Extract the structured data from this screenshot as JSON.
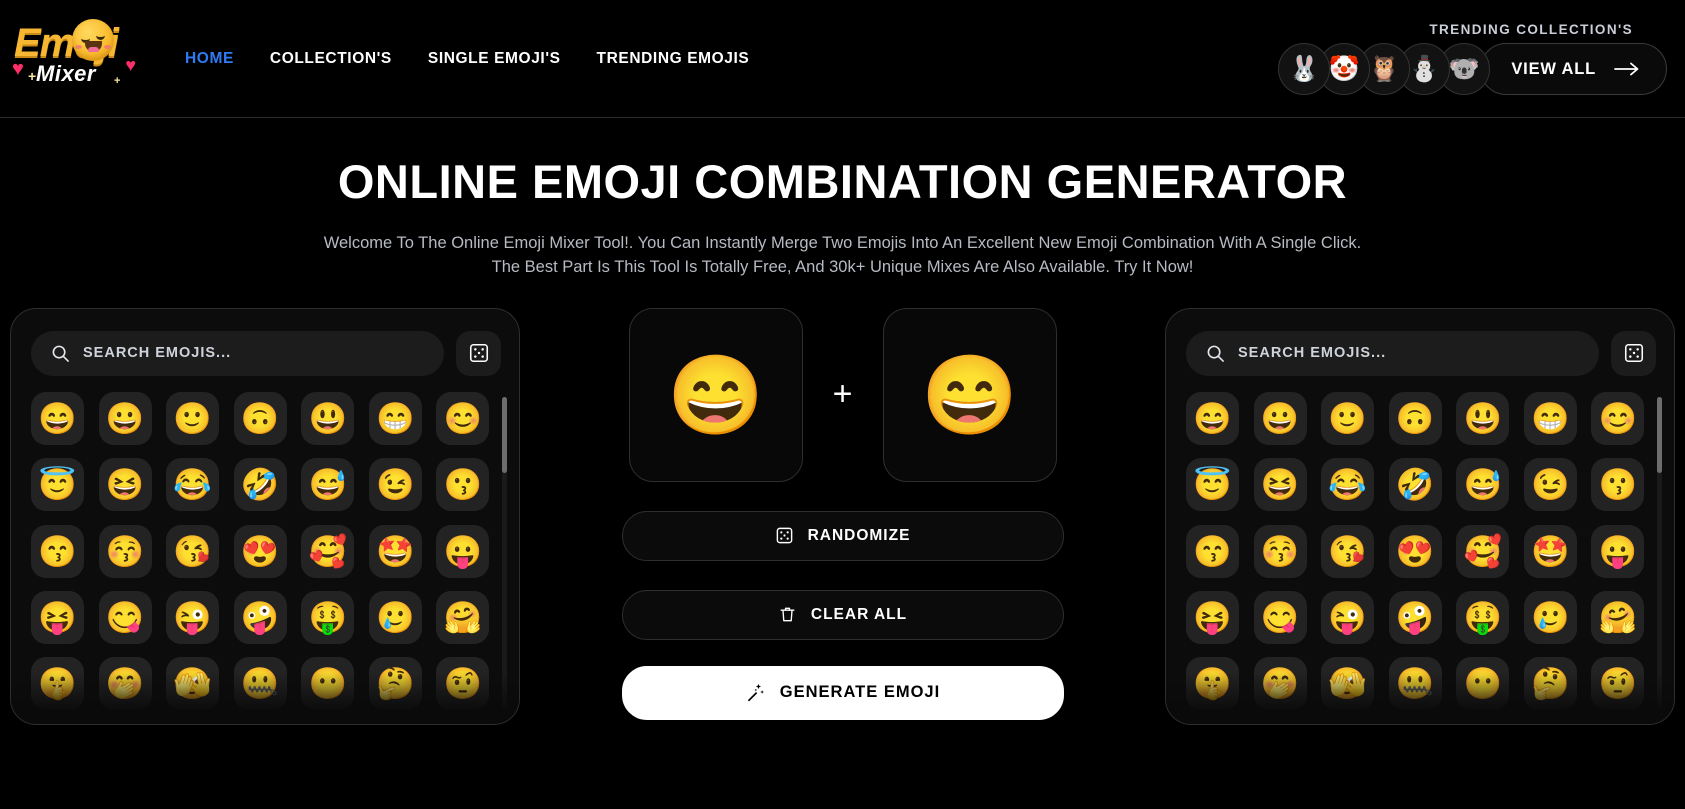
{
  "brand": {
    "logo_word": "Emoji",
    "logo_sub": "Mixer",
    "logo_plus_left": "+",
    "logo_plus_right": "+",
    "heart": "♥"
  },
  "nav": {
    "items": [
      {
        "label": "HOME",
        "active": true
      },
      {
        "label": "COLLECTION'S",
        "active": false
      },
      {
        "label": "SINGLE EMOJI'S",
        "active": false
      },
      {
        "label": "TRENDING EMOJIS",
        "active": false
      }
    ]
  },
  "header": {
    "trending_label": "TRENDING COLLECTION'S",
    "view_all_label": "VIEW ALL",
    "arrow_icon": "→",
    "avatars": [
      {
        "name": "rabbit-sunglasses-emoji",
        "glyph": "🐰"
      },
      {
        "name": "clown-cowboy-emoji",
        "glyph": "🤡"
      },
      {
        "name": "owl-emoji",
        "glyph": "🦉"
      },
      {
        "name": "snowman-flower-emoji",
        "glyph": "⛄"
      },
      {
        "name": "koala-fire-emoji",
        "glyph": "🐨"
      }
    ]
  },
  "hero": {
    "title": "ONLINE EMOJI COMBINATION GENERATOR",
    "subtitle": "Welcome To The Online Emoji Mixer Tool!. You Can Instantly Merge Two Emojis Into An Excellent New Emoji Combination With A Single Click. The Best Part Is This Tool Is Totally Free, And 30k+ Unique Mixes Are Also Available. Try It Now!"
  },
  "picker_left": {
    "search_placeholder": "SEARCH EMOJIS...",
    "search_value": "",
    "dice_icon": "dice-icon",
    "emojis": [
      "😄",
      "😀",
      "🙂",
      "🙃",
      "😃",
      "😁",
      "😊",
      "😇",
      "😆",
      "😂",
      "🤣",
      "😅",
      "😉",
      "😗",
      "😙",
      "😚",
      "😘",
      "😍",
      "🥰",
      "🤩",
      "😛",
      "😝",
      "😋",
      "😜",
      "🤪",
      "🤑",
      "🥲",
      "🤗",
      "🤫",
      "🤭",
      "🫣",
      "🤐",
      "😶",
      "🤔",
      "🤨"
    ]
  },
  "picker_right": {
    "search_placeholder": "SEARCH EMOJIS...",
    "search_value": "",
    "dice_icon": "dice-icon",
    "emojis": [
      "😄",
      "😀",
      "🙂",
      "🙃",
      "😃",
      "😁",
      "😊",
      "😇",
      "😆",
      "😂",
      "🤣",
      "😅",
      "😉",
      "😗",
      "😙",
      "😚",
      "😘",
      "😍",
      "🥰",
      "🤩",
      "😛",
      "😝",
      "😋",
      "😜",
      "🤪",
      "🤑",
      "🥲",
      "🤗",
      "🤫",
      "🤭",
      "🫣",
      "🤐",
      "😶",
      "🤔",
      "🤨"
    ]
  },
  "mixer": {
    "slot_one_emoji": "😄",
    "slot_two_emoji": "😄",
    "plus": "+",
    "randomize_label": "RANDOMIZE",
    "clear_all_label": "CLEAR ALL",
    "generate_label": "GENERATE EMOJI"
  },
  "colors": {
    "page_bg": "#000000",
    "panel_bg": "#0c0c0c",
    "panel_border": "#2e2e2e",
    "cell_bg": "#232323",
    "accent_blue": "#2f7bf6",
    "text_muted": "#b6bac2",
    "generate_bg": "#ffffff"
  }
}
